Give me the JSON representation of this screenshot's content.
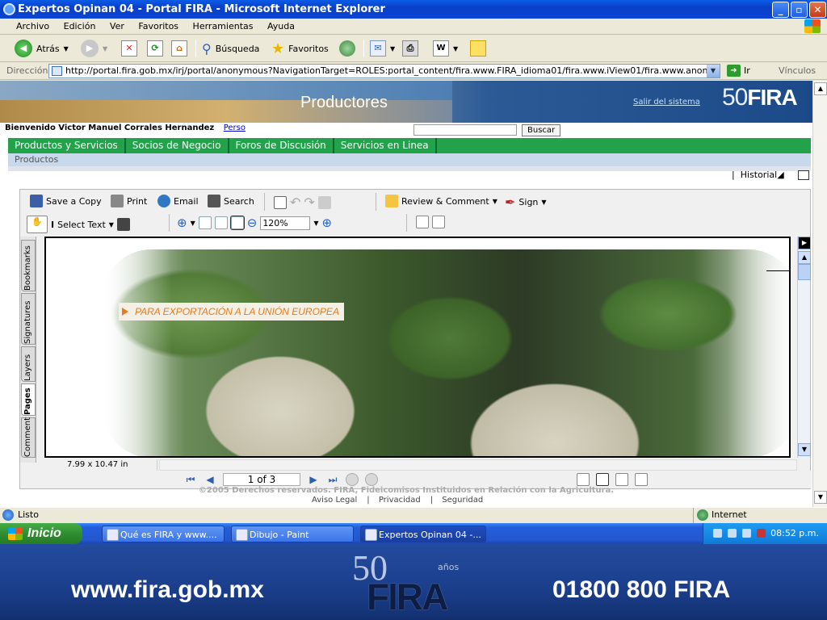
{
  "window": {
    "title": "Expertos Opinan 04 - Portal FIRA - Microsoft Internet Explorer"
  },
  "menubar": {
    "items": [
      "Archivo",
      "Edición",
      "Ver",
      "Favoritos",
      "Herramientas",
      "Ayuda"
    ]
  },
  "toolbar": {
    "back_label": "Atrás",
    "search_label": "Búsqueda",
    "favorites_label": "Favoritos"
  },
  "address": {
    "label": "Dirección",
    "url": "http://portal.fira.gob.mx/irj/portal/anonymous?NavigationTarget=ROLES:portal_content/fira.www.FIRA_idioma01/fira.www.iView01/fira.www.anonimo01/fira.www.",
    "go_label": "Ir",
    "links_label": "Vínculos"
  },
  "portal": {
    "banner_title": "Productores",
    "logout_label": "Salir del sistema",
    "logo_number": "50",
    "logo_text": "FIRA",
    "welcome": "Bienvenido Victor Manuel Corrales Hernandez",
    "profile_link": "Perso",
    "search_button": "Buscar",
    "nav": [
      "Productos y Servicios",
      "Socios de Negocio",
      "Foros de Discusión",
      "Servicios en Linea"
    ],
    "subnav": "Productos",
    "history_label": "Historial"
  },
  "acrobat": {
    "toolbar1": {
      "save": "Save a Copy",
      "print": "Print",
      "email": "Email",
      "search": "Search",
      "review": "Review & Comment",
      "sign": "Sign"
    },
    "toolbar2": {
      "select_text": "Select Text",
      "zoom": "120%"
    },
    "side_tabs": [
      "Bookmarks",
      "Signatures",
      "Layers",
      "Pages",
      "Comment"
    ],
    "doc_banner": "PARA EXPORTACIÓN A LA UNIÓN EUROPEA",
    "page_size": "7.99 x 10.47 in",
    "page_indicator": "1 of 3"
  },
  "footer": {
    "copyright": "©2005 Derechos reservados. FIRA, Fideicomisos Instituidos en Relación con la Agricultura.",
    "links": [
      "Aviso Legal",
      "Privacidad",
      "Seguridad"
    ]
  },
  "statusbar": {
    "status": "Listo",
    "zone": "Internet"
  },
  "taskbar": {
    "start_label": "Inicio",
    "tasks": [
      "Qué es FIRA y www....",
      "Dibujo - Paint",
      "Expertos Opinan 04 -..."
    ],
    "clock": "08:52 p.m."
  },
  "slide": {
    "url": "www.fira.gob.mx",
    "phone": "01800 800 FIRA",
    "logo_number": "50",
    "logo_years": "años",
    "logo_text": "FIRA"
  },
  "colors": {
    "title_blue": "#0a5ce8",
    "nav_green": "#22a24a",
    "banner_orange": "#e87a18",
    "slide_blue": "#1b3e8b"
  }
}
